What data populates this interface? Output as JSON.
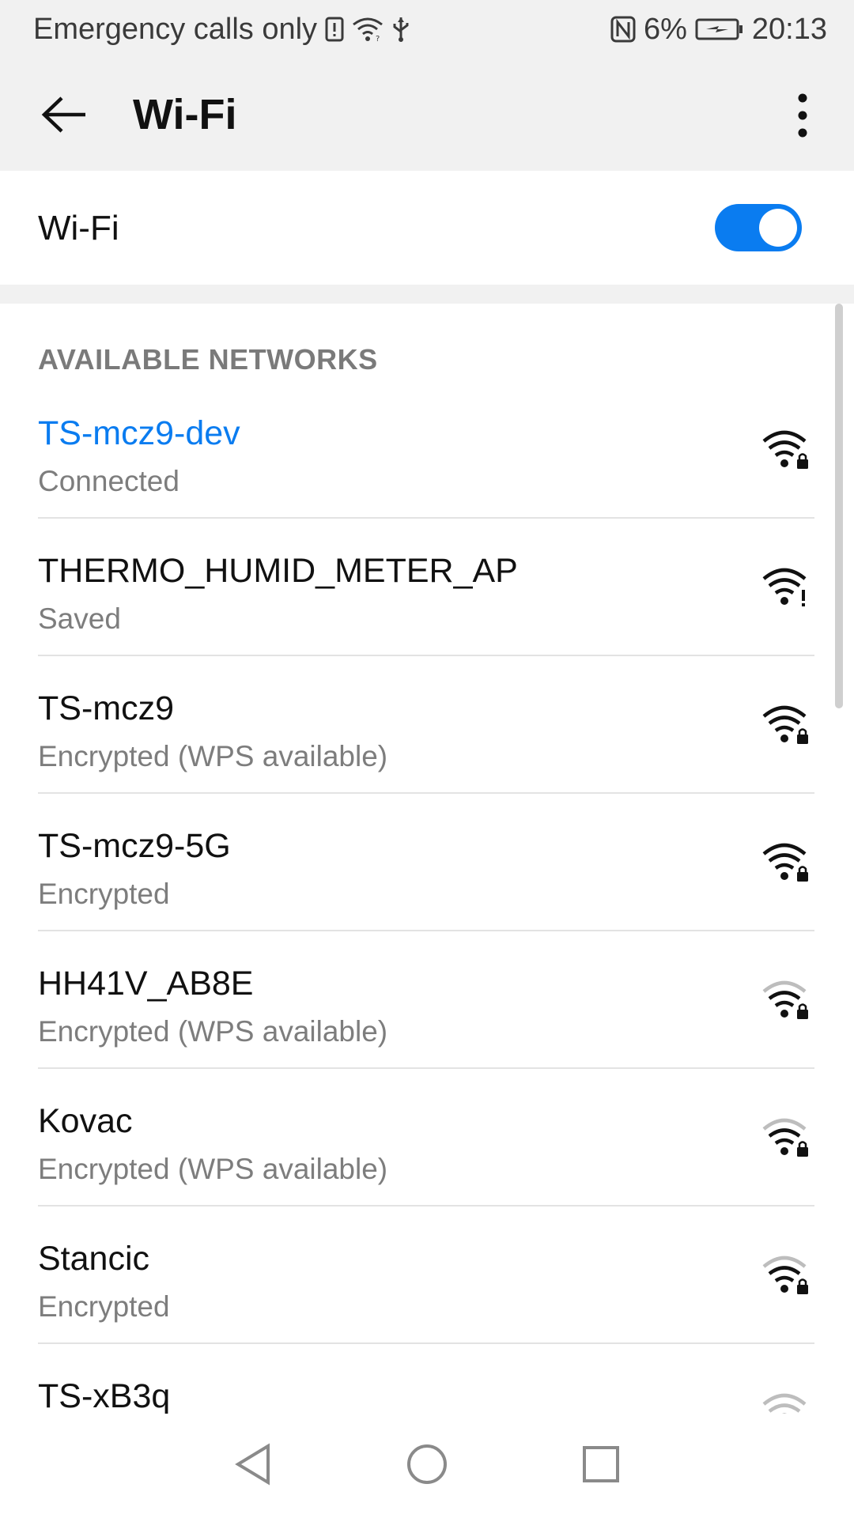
{
  "status_bar": {
    "carrier_text": "Emergency calls only",
    "battery_percent": "6%",
    "time": "20:13",
    "icons": [
      "sim-alert-icon",
      "wifi-icon",
      "usb-icon",
      "nfc-icon",
      "battery-charging-icon"
    ]
  },
  "app_bar": {
    "title": "Wi-Fi",
    "back_icon": "back-arrow-icon",
    "menu_icon": "more-vert-icon"
  },
  "wifi_toggle": {
    "label": "Wi-Fi",
    "enabled": true,
    "accent_color": "#0a7cf0"
  },
  "networks": {
    "header": "AVAILABLE NETWORKS",
    "items": [
      {
        "name": "TS-mcz9-dev",
        "status": "Connected",
        "signal_bars": 4,
        "secured": true,
        "connected": true
      },
      {
        "name": "THERMO_HUMID_METER_AP",
        "status": "Saved",
        "signal_bars": 4,
        "secured": false,
        "warning": true
      },
      {
        "name": "TS-mcz9",
        "status": "Encrypted (WPS available)",
        "signal_bars": 4,
        "secured": true
      },
      {
        "name": "TS-mcz9-5G",
        "status": "Encrypted",
        "signal_bars": 4,
        "secured": true
      },
      {
        "name": "HH41V_AB8E",
        "status": "Encrypted (WPS available)",
        "signal_bars": 3,
        "secured": true
      },
      {
        "name": "Kovac",
        "status": "Encrypted (WPS available)",
        "signal_bars": 3,
        "secured": true
      },
      {
        "name": "Stancic",
        "status": "Encrypted",
        "signal_bars": 3,
        "secured": true
      },
      {
        "name": "TS-xB3q",
        "status": "",
        "signal_bars": 2,
        "secured": true
      }
    ]
  },
  "nav_bar": {
    "buttons": [
      "back-triangle-icon",
      "home-circle-icon",
      "recents-square-icon"
    ]
  }
}
